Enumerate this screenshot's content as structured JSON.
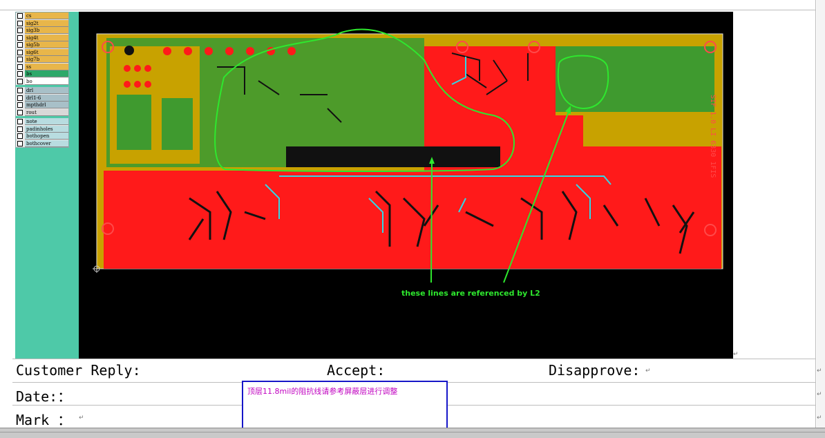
{
  "layers": [
    {
      "name": "cs",
      "color": "#e8b64a"
    },
    {
      "name": "sig2t",
      "color": "#e8b64a"
    },
    {
      "name": "sig3b",
      "color": "#e8b64a"
    },
    {
      "name": "sig4t",
      "color": "#e8b64a"
    },
    {
      "name": "sig5b",
      "color": "#e8b64a"
    },
    {
      "name": "sig6t",
      "color": "#e8b64a"
    },
    {
      "name": "sig7b",
      "color": "#e8b64a"
    },
    {
      "name": "ss",
      "color": "#e8b64a"
    },
    {
      "name": "bs",
      "color": "#2ea86a"
    },
    {
      "name": "bo",
      "color": "#ffffff"
    },
    {
      "name": "drl",
      "color": "#a8c0c8"
    },
    {
      "name": "drl1-6",
      "color": "#a8c0c8"
    },
    {
      "name": "mpthdrl",
      "color": "#a8c0c8"
    },
    {
      "name": "rout",
      "color": "#d8d8d8"
    },
    {
      "name": "note",
      "color": "#b8dce0"
    },
    {
      "name": "padinholes",
      "color": "#b8dce0"
    },
    {
      "name": "bothopen",
      "color": "#b8dce0"
    },
    {
      "name": "bothcover",
      "color": "#b8dce0"
    }
  ],
  "pcb": {
    "annotation": "these lines are referenced by L2",
    "side_label": "SIF 1.0 LI 6330 1FIS",
    "colors": {
      "board_bg": "#c8a200",
      "copper": "#ff1a1a",
      "green_region": "#3f9a2f",
      "annotation": "#2ee82e",
      "trace": "#2fd9e8"
    }
  },
  "reply": {
    "customer_reply": "Customer Reply:",
    "accept": "Accept:",
    "disapprove": "Disapprove:",
    "date": "Date:：",
    "mark": "Mark ："
  },
  "comment": {
    "text": "顶层11.8mil的阻抗线请参考屏蔽层进行调整"
  },
  "paragraph_mark": "↵"
}
